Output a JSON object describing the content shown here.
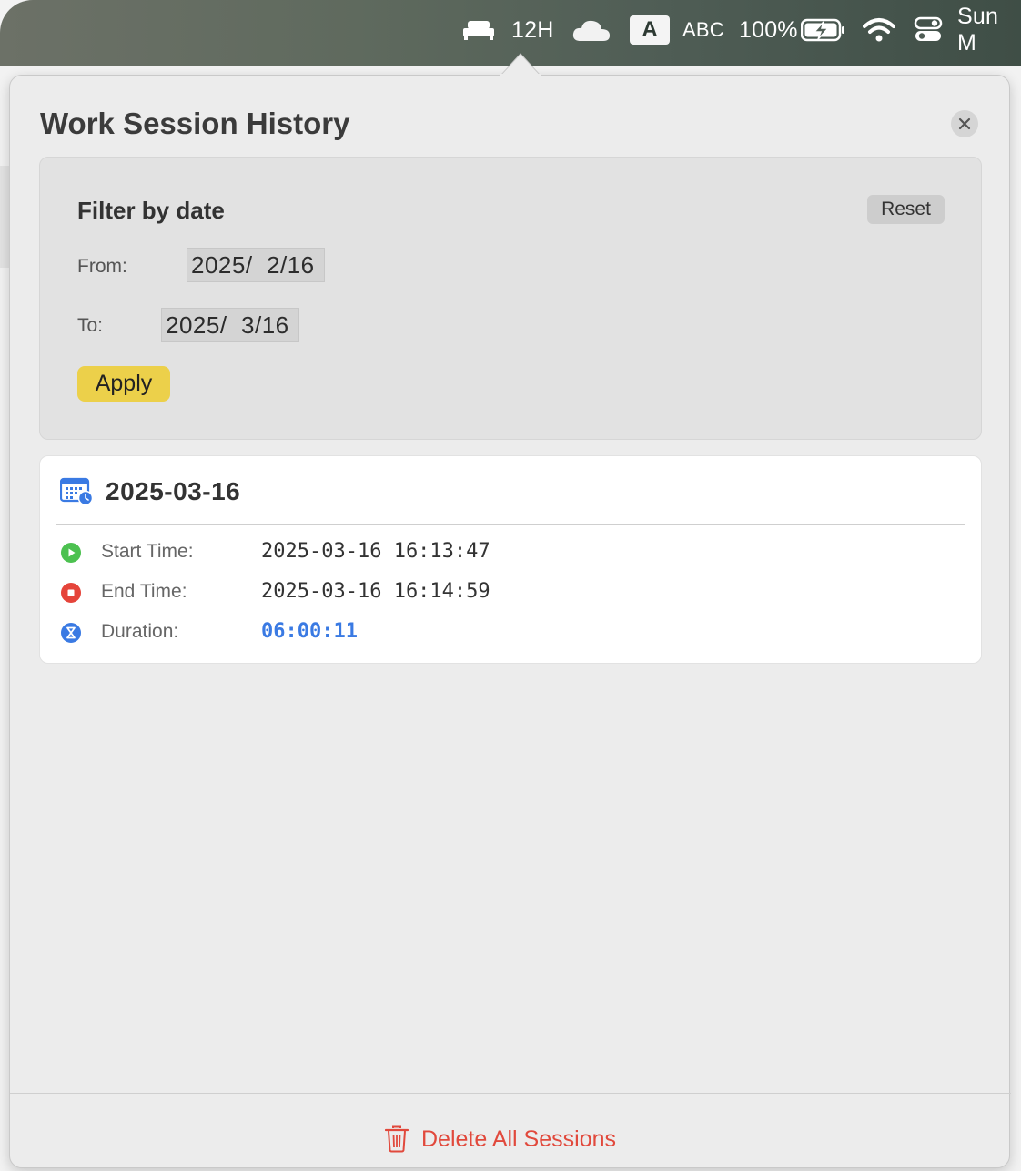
{
  "menubar": {
    "sleep_icon": "bed-icon",
    "time_format": "12H",
    "cloud_icon": "cloud-icon",
    "input_badge": "A",
    "input_source": "ABC",
    "battery_percent": "100%",
    "battery_icon": "battery-charging-icon",
    "wifi_icon": "wifi-icon",
    "control_center_icon": "control-center-icon",
    "datetime": "Sun M"
  },
  "popover": {
    "title": "Work Session History",
    "close_icon": "close-icon"
  },
  "filter": {
    "title": "Filter by date",
    "reset_label": "Reset",
    "from_label": "From:",
    "from_value": "2025/  2/16",
    "to_label": "To:",
    "to_value": "2025/  3/16",
    "apply_label": "Apply"
  },
  "sessions": [
    {
      "date": "2025-03-16",
      "start_label": "Start Time:",
      "start_value": "2025-03-16 16:13:47",
      "end_label": "End Time:",
      "end_value": "2025-03-16 16:14:59",
      "duration_label": "Duration:",
      "duration_value": "06:00:11"
    }
  ],
  "footer": {
    "delete_label": "Delete All Sessions"
  },
  "colors": {
    "accent_yellow": "#ecd04a",
    "danger_red": "#e1493c",
    "start_green": "#4cc150",
    "end_red": "#e5443a",
    "duration_blue": "#3a7ae3"
  }
}
